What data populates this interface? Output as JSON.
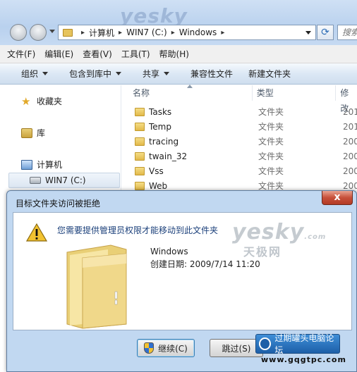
{
  "explorer": {
    "watermark": "yesky",
    "breadcrumb": [
      "计算机",
      "WIN7 (C:)",
      "Windows"
    ],
    "search_placeholder": "搜索",
    "menu": [
      "文件(F)",
      "编辑(E)",
      "查看(V)",
      "工具(T)",
      "帮助(H)"
    ],
    "toolbar": {
      "organize": "组织",
      "include_library": "包含到库中",
      "share": "共享",
      "compat_files": "兼容性文件",
      "new_folder": "新建文件夹"
    },
    "nav": {
      "favorites": "收藏夹",
      "library": "库",
      "computer": "计算机",
      "drive": "WIN7 (C:)"
    },
    "columns": {
      "name": "名称",
      "type": "类型",
      "modified": "修改"
    },
    "rows": [
      {
        "name": "Tasks",
        "type": "文件夹",
        "date": "201"
      },
      {
        "name": "Temp",
        "type": "文件夹",
        "date": "201"
      },
      {
        "name": "tracing",
        "type": "文件夹",
        "date": "200"
      },
      {
        "name": "twain_32",
        "type": "文件夹",
        "date": "200"
      },
      {
        "name": "Vss",
        "type": "文件夹",
        "date": "200"
      },
      {
        "name": "Web",
        "type": "文件夹",
        "date": "200"
      }
    ]
  },
  "dialog": {
    "title": "目标文件夹访问被拒绝",
    "close": "x",
    "message": "您需要提供管理员权限才能移动到此文件夹",
    "folder_name": "Windows",
    "created": "创建日期: 2009/7/14 11:20",
    "continue_btn": "继续(C)",
    "skip_btn": "跳过(S)",
    "watermark_main": "yesky",
    "watermark_dot": ".com",
    "watermark_cn": "天极网"
  },
  "overlay": {
    "forum": "过期罐头电脑论坛",
    "url": "www.gqgtpc.com"
  },
  "colors": {
    "accent": "#2f6db6",
    "close_red": "#c7503a",
    "folder_yellow": "#e6c35c"
  }
}
